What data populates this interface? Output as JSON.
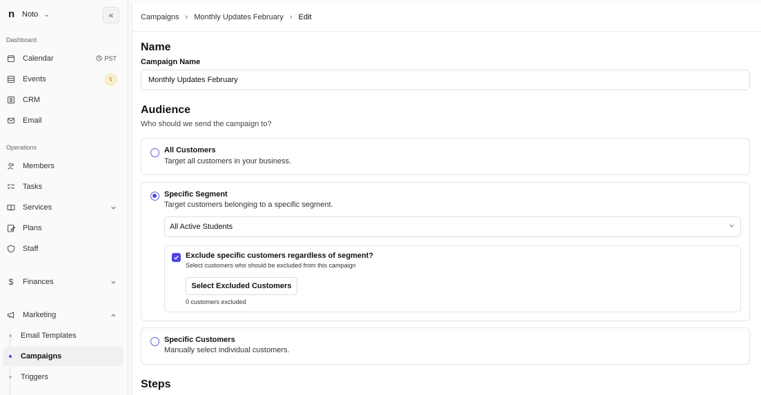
{
  "sidebar": {
    "brand": "Noto",
    "brand_logo": "n",
    "sections": {
      "dashboard": "Dashboard",
      "operations": "Operations"
    },
    "items": {
      "calendar": {
        "label": "Calendar",
        "extra": "PST"
      },
      "events": {
        "label": "Events",
        "badge": "5"
      },
      "crm": {
        "label": "CRM"
      },
      "email": {
        "label": "Email"
      },
      "members": {
        "label": "Members"
      },
      "tasks": {
        "label": "Tasks"
      },
      "services": {
        "label": "Services"
      },
      "plans": {
        "label": "Plans"
      },
      "staff": {
        "label": "Staff"
      },
      "finances": {
        "label": "Finances"
      },
      "marketing": {
        "label": "Marketing"
      }
    },
    "marketing_sub": {
      "email_templates": "Email Templates",
      "campaigns": "Campaigns",
      "triggers": "Triggers"
    }
  },
  "breadcrumb": {
    "campaigns": "Campaigns",
    "campaign": "Monthly Updates February",
    "current": "Edit"
  },
  "name_section": {
    "heading": "Name",
    "field_label": "Campaign Name",
    "value": "Monthly Updates February"
  },
  "audience": {
    "heading": "Audience",
    "description": "Who should we send the campaign to?",
    "options": {
      "all": {
        "title": "All Customers",
        "desc": "Target all customers in your business.",
        "checked": false
      },
      "segment": {
        "title": "Specific Segment",
        "desc": "Target customers belonging to a specific segment.",
        "checked": true
      },
      "specific": {
        "title": "Specific Customers",
        "desc": "Manually select individual customers.",
        "checked": false
      }
    },
    "segment_select": "All Active Students",
    "exclude": {
      "title": "Exclude specific customers regardless of segment?",
      "desc": "Select customers who should be excluded from this campaign",
      "button": "Select Excluded Customers",
      "count": "0 customers excluded",
      "checked": true
    }
  },
  "steps": {
    "heading": "Steps"
  },
  "colors": {
    "accent": "#4f46e5",
    "badge_bg": "#fdf2cf"
  }
}
